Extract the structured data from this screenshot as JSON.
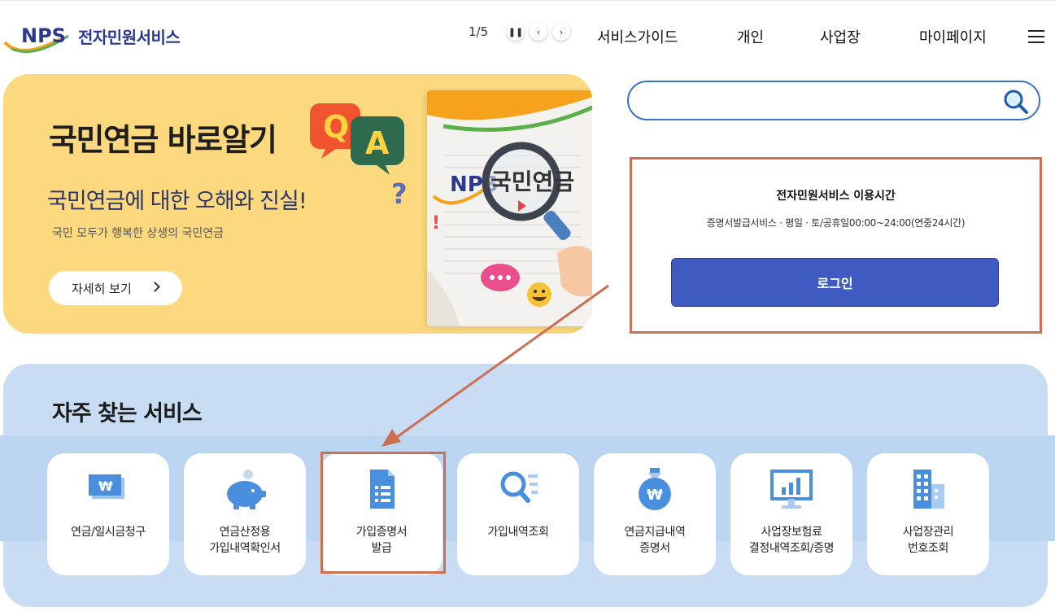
{
  "header": {
    "logo_mark": "NPS",
    "logo_text": "전자민원서비스",
    "nav": [
      "서비스가이드",
      "개인",
      "사업장",
      "마이페이지"
    ]
  },
  "banner": {
    "title": "국민연금 바로알기",
    "qa_q": "Q",
    "qa_a": "A",
    "subtitle": "국민연금에 대한 오해와 진실!",
    "description": "국민 모두가 행복한 상생의 국민연금",
    "more_label": "자세히 보기",
    "slide_counter": "1/5",
    "paper_text": "국민연금",
    "paper_logo": "NPS"
  },
  "search": {
    "value": "",
    "placeholder": ""
  },
  "login": {
    "title": "전자민원서비스 이용시간",
    "hours": "증명서발급서비스 · 평일 · 토/공휴일00:00~24:00(연중24시간)",
    "button": "로그인"
  },
  "services": {
    "title": "자주 찾는 서비스",
    "items": [
      {
        "line1": "연금/일시금청구",
        "line2": "",
        "icon": "won-card-icon"
      },
      {
        "line1": "연금산정용",
        "line2": "가입내역확인서",
        "icon": "piggy-bank-icon"
      },
      {
        "line1": "가입증명서",
        "line2": "발급",
        "icon": "document-icon"
      },
      {
        "line1": "가입내역조회",
        "line2": "",
        "icon": "search-list-icon"
      },
      {
        "line1": "연금지급내역",
        "line2": "증명서",
        "icon": "money-bag-icon"
      },
      {
        "line1": "사업장보험료",
        "line2": "결정내역조회/증명",
        "icon": "monitor-chart-icon"
      },
      {
        "line1": "사업장관리",
        "line2": "번호조회",
        "icon": "building-icon"
      }
    ]
  },
  "colors": {
    "accent_blue": "#3f5bc2",
    "banner_yellow": "#fcd97e",
    "services_bg": "#c8ddf4",
    "annotation": "#cc6f52",
    "icon_blue": "#4a8fde"
  }
}
